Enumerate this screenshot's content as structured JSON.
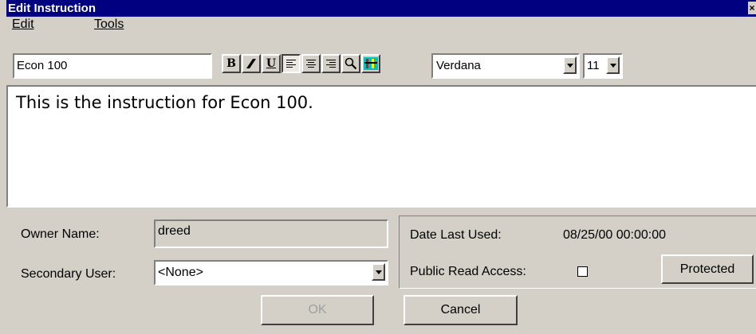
{
  "window": {
    "title": "Edit Instruction",
    "close_glyph": "×"
  },
  "menu": {
    "edit": "Edit",
    "tools": "Tools"
  },
  "toolbar": {
    "name_value": "Econ 100",
    "font_value": "Verdana",
    "size_value": "11",
    "bold_label": "B",
    "underline_label": "U"
  },
  "editor": {
    "text": "This is the instruction for Econ 100."
  },
  "owner": {
    "label": "Owner Name:",
    "value": "dreed"
  },
  "secondary": {
    "label": "Secondary User:",
    "value": "<None>"
  },
  "info": {
    "date_label": "Date Last Used:",
    "date_value": "08/25/00 00:00:00",
    "public_label": "Public Read Access:",
    "public_checked": false,
    "protected_label": "Protected"
  },
  "buttons": {
    "ok": "OK",
    "cancel": "Cancel"
  }
}
